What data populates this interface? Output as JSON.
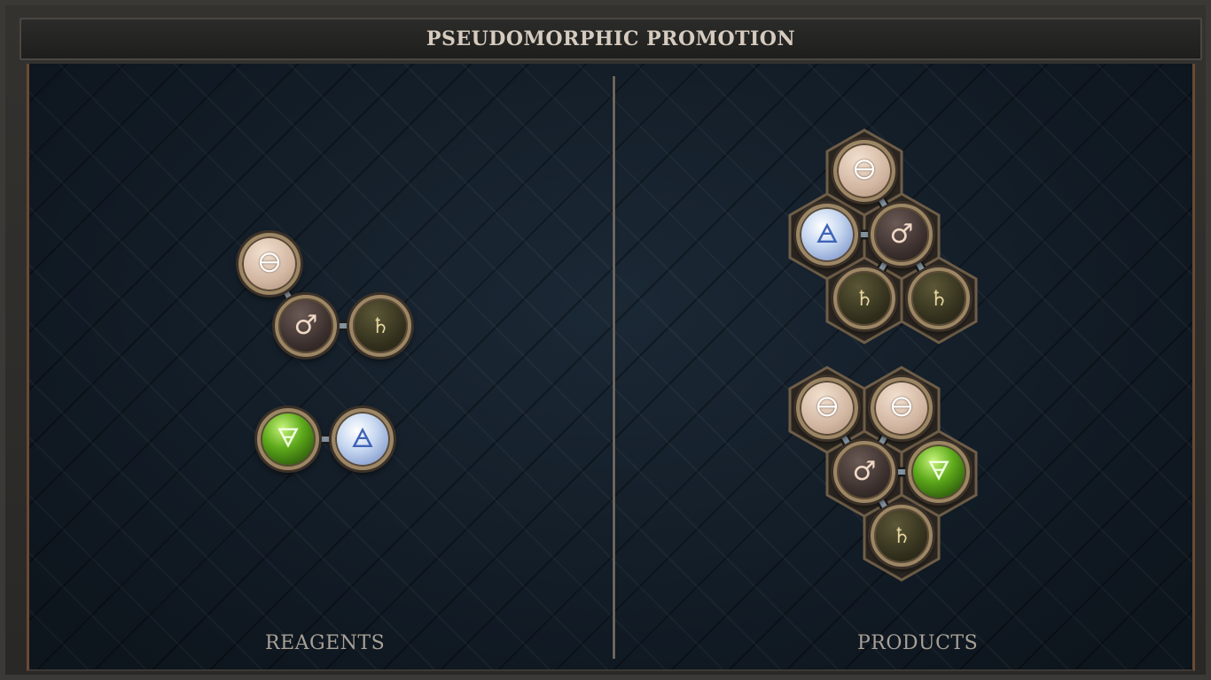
{
  "title": "PSEUDOMORPHIC PROMOTION",
  "panels": {
    "reagents_label": "REAGENTS",
    "products_label": "PRODUCTS"
  },
  "elements": {
    "salt": {
      "glyph": "🜔",
      "icon": "salt-icon"
    },
    "iron": {
      "glyph": "♂",
      "icon": "iron-icon"
    },
    "lead": {
      "glyph": "♄",
      "icon": "lead-icon"
    },
    "earth": {
      "glyph": "🜃",
      "icon": "earth-icon"
    },
    "air": {
      "glyph": "🜁",
      "icon": "air-icon"
    }
  },
  "colors": {
    "frame": "#3b3935",
    "board": "#0f1820",
    "accent_border": "#6a4a32",
    "title_text": "#d6cbbf",
    "label_text": "#a8a096",
    "atom_rim": "#9c8664",
    "bond": "#8a9aa6"
  },
  "reagents": [
    {
      "name": "reagent-1",
      "atoms": [
        "salt",
        "iron",
        "lead"
      ],
      "bonds": [
        [
          0,
          1
        ],
        [
          1,
          2
        ]
      ]
    },
    {
      "name": "reagent-2",
      "atoms": [
        "earth",
        "air"
      ],
      "bonds": [
        [
          0,
          1
        ]
      ]
    }
  ],
  "products": [
    {
      "name": "product-1",
      "atoms": [
        "salt",
        "air",
        "iron",
        "lead",
        "lead"
      ],
      "bonds": [
        [
          0,
          2
        ],
        [
          1,
          2
        ],
        [
          2,
          3
        ],
        [
          2,
          4
        ]
      ]
    },
    {
      "name": "product-2",
      "atoms": [
        "salt",
        "salt",
        "iron",
        "earth",
        "lead"
      ],
      "bonds": [
        [
          0,
          2
        ],
        [
          1,
          2
        ],
        [
          2,
          3
        ],
        [
          2,
          4
        ]
      ]
    }
  ]
}
